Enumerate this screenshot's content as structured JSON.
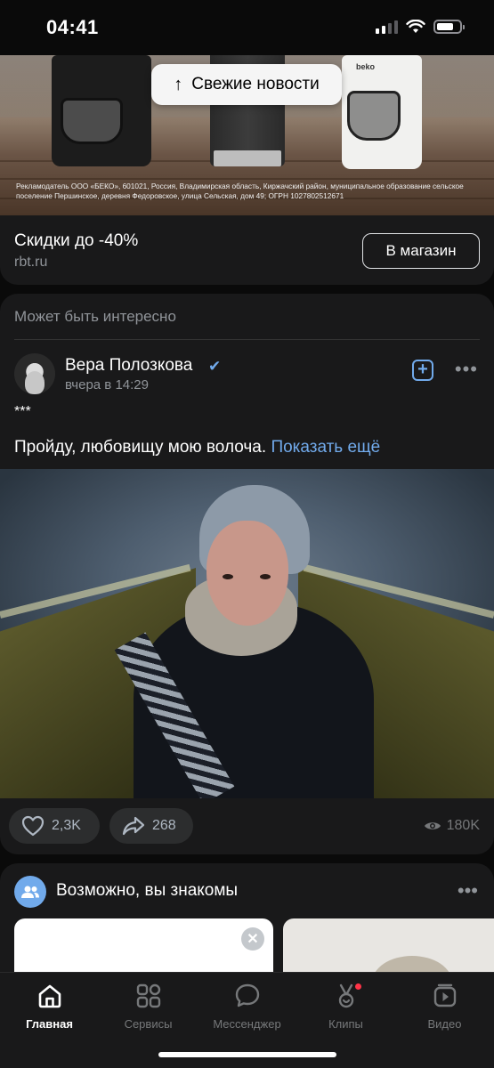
{
  "status": {
    "time": "04:41",
    "battery_level": 0.75
  },
  "ad": {
    "fresh_news_label": "Свежие новости",
    "brand_text": "beko",
    "legal_text": "Рекламодатель ООО «БЕКО», 601021, Россия, Владимирская область, Киржачский район, муниципальное образование сельское поселение Першинское, деревня Федоровское, улица Сельская, дом 49; ОГРН 1027802512671",
    "title": "Скидки до -40%",
    "domain": "rbt.ru",
    "shop_button_label": "В магазин"
  },
  "post": {
    "section_header": "Может быть интересно",
    "author_name": "Вера Полозкова",
    "time": "вчера в 14:29",
    "stars": "***",
    "text": "Пройду, любовищу мою волоча.",
    "show_more_label": "Показать ещё",
    "likes": "2,3K",
    "shares": "268",
    "views": "180K"
  },
  "friends": {
    "title": "Возможно, вы знакомы"
  },
  "tabs": [
    {
      "label": "Главная",
      "icon": "home-icon",
      "active": true
    },
    {
      "label": "Сервисы",
      "icon": "services-icon",
      "active": false
    },
    {
      "label": "Мессенджер",
      "icon": "messenger-icon",
      "active": false
    },
    {
      "label": "Клипы",
      "icon": "clips-icon",
      "active": false
    },
    {
      "label": "Видео",
      "icon": "video-icon",
      "active": false
    }
  ],
  "colors": {
    "accent": "#71aaeb",
    "background": "#0a0a0a",
    "card": "#19191a",
    "notification": "#ff3347"
  }
}
